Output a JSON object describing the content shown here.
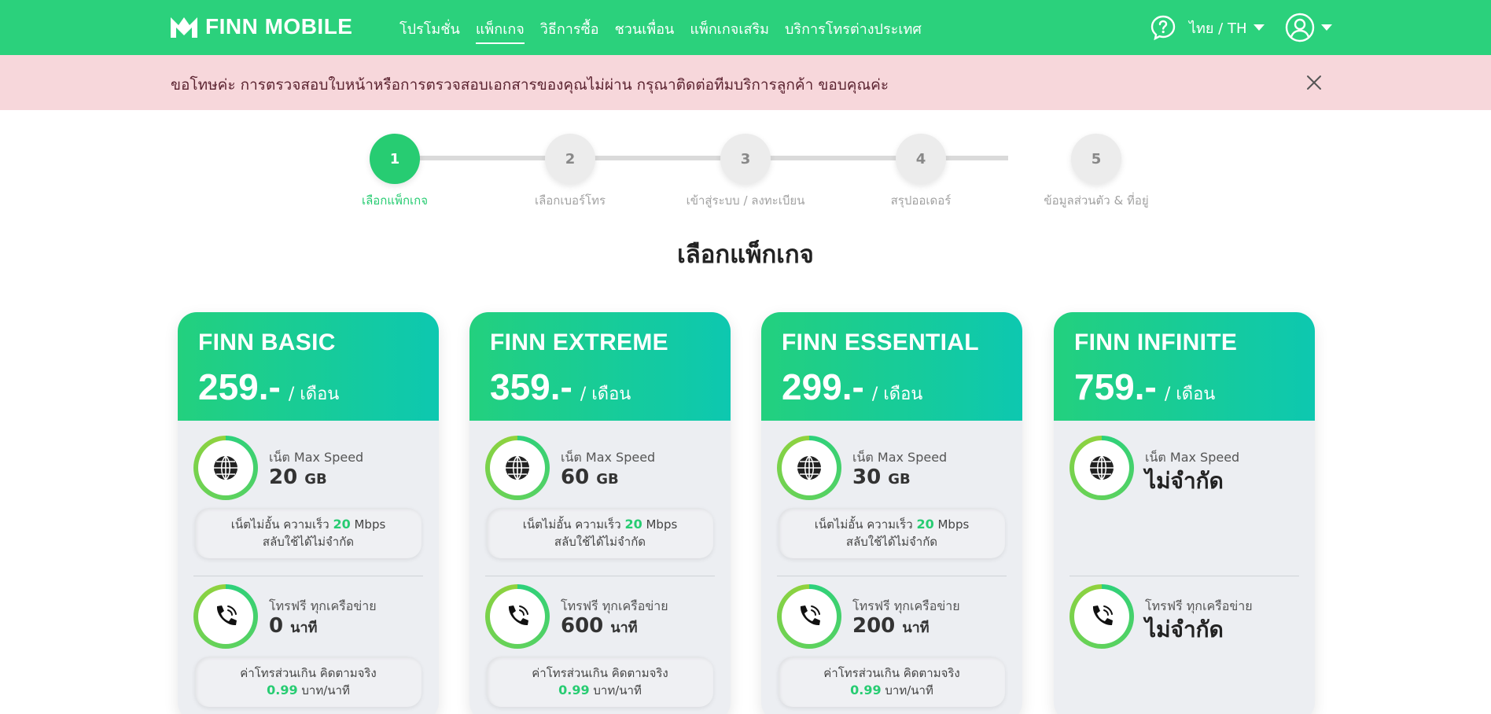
{
  "brand": {
    "name": "FINN MOBILE",
    "accent": "#2bd17c"
  },
  "nav": {
    "items": [
      {
        "label": "โปรโมชั่น"
      },
      {
        "label": "แพ็กเกจ",
        "active": true
      },
      {
        "label": "วิธีการซื้อ"
      },
      {
        "label": "ชวนเพื่อน"
      },
      {
        "label": "แพ็กเกจเสริม"
      },
      {
        "label": "บริการโทรต่างประเทศ"
      }
    ],
    "language": "ไทย / TH",
    "help_icon": "question-bubble-icon",
    "user_icon": "user-circle-icon"
  },
  "alert": {
    "text": "ขอโทษค่ะ การตรวจสอบใบหน้าหรือการตรวจสอบเอกสารของคุณไม่ผ่าน กรุณาติดต่อทีมบริการลูกค้า ขอบคุณค่ะ",
    "color": "#f7d7db"
  },
  "stepper": {
    "steps": [
      {
        "num": "1",
        "label": "เลือกแพ็กเกจ",
        "active": true
      },
      {
        "num": "2",
        "label": "เลือกเบอร์โทร"
      },
      {
        "num": "3",
        "label": "เข้าสู่ระบบ / ลงทะเบียน"
      },
      {
        "num": "4",
        "label": "สรุปออเดอร์"
      },
      {
        "num": "5",
        "label": "ข้อมูลส่วนตัว & ที่อยู่"
      }
    ]
  },
  "page": {
    "title": "เลือกแพ็กเกจ"
  },
  "plans": [
    {
      "name": "FINN BASIC",
      "price": "259.-",
      "per": "/ เดือน",
      "data_label": "เน็ต Max Speed",
      "data_value": "20",
      "data_unit": "GB",
      "speed_prefix": "เน็ตไม่อั้น ความเร็ว",
      "speed_value": "20",
      "speed_unit": "Mbps",
      "speed_line2": "สลับใช้ได้ไม่จำกัด",
      "call_label": "โทรฟรี ทุกเครือข่าย",
      "call_value": "0",
      "call_unit": "นาที",
      "extra_line1": "ค่าโทรส่วนเกิน คิดตามจริง",
      "extra_value": "0.99",
      "extra_unit": "บาท/นาที"
    },
    {
      "name": "FINN EXTREME",
      "price": "359.-",
      "per": "/ เดือน",
      "data_label": "เน็ต Max Speed",
      "data_value": "60",
      "data_unit": "GB",
      "speed_prefix": "เน็ตไม่อั้น ความเร็ว",
      "speed_value": "20",
      "speed_unit": "Mbps",
      "speed_line2": "สลับใช้ได้ไม่จำกัด",
      "call_label": "โทรฟรี ทุกเครือข่าย",
      "call_value": "600",
      "call_unit": "นาที",
      "extra_line1": "ค่าโทรส่วนเกิน คิดตามจริง",
      "extra_value": "0.99",
      "extra_unit": "บาท/นาที"
    },
    {
      "name": "FINN ESSENTIAL",
      "price": "299.-",
      "per": "/ เดือน",
      "data_label": "เน็ต Max Speed",
      "data_value": "30",
      "data_unit": "GB",
      "speed_prefix": "เน็ตไม่อั้น ความเร็ว",
      "speed_value": "20",
      "speed_unit": "Mbps",
      "speed_line2": "สลับใช้ได้ไม่จำกัด",
      "call_label": "โทรฟรี ทุกเครือข่าย",
      "call_value": "200",
      "call_unit": "นาที",
      "extra_line1": "ค่าโทรส่วนเกิน คิดตามจริง",
      "extra_value": "0.99",
      "extra_unit": "บาท/นาที"
    },
    {
      "name": "FINN INFINITE",
      "price": "759.-",
      "per": "/ เดือน",
      "data_label": "เน็ต Max Speed",
      "data_value_text": "ไม่จำกัด",
      "call_label": "โทรฟรี ทุกเครือข่าย",
      "call_value_text": "ไม่จำกัด"
    }
  ]
}
